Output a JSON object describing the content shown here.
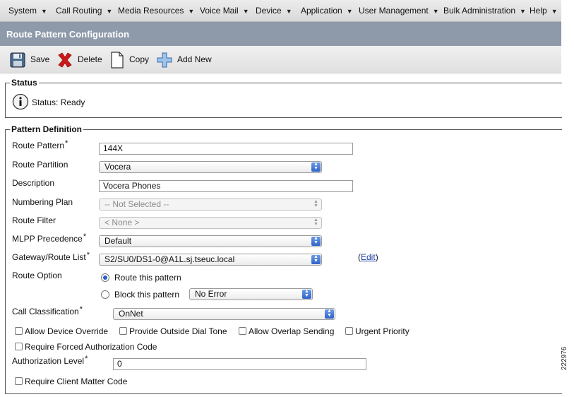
{
  "menu": [
    "System",
    "Call Routing",
    "Media Resources",
    "Voice Mail",
    "Device",
    "Application",
    "User Management",
    "Bulk Administration",
    "Help"
  ],
  "page_title": "Route Pattern Configuration",
  "toolbar": {
    "save": "Save",
    "delete": "Delete",
    "copy": "Copy",
    "add_new": "Add New"
  },
  "status": {
    "legend": "Status",
    "text": "Status: Ready"
  },
  "pattern": {
    "legend": "Pattern Definition",
    "route_pattern_label": "Route Pattern",
    "route_pattern_value": "144X",
    "route_partition_label": "Route Partition",
    "route_partition_value": "Vocera",
    "description_label": "Description",
    "description_value": "Vocera Phones",
    "numbering_plan_label": "Numbering Plan",
    "numbering_plan_value": "-- Not Selected --",
    "route_filter_label": "Route Filter",
    "route_filter_value": "< None >",
    "mlpp_label": "MLPP Precedence",
    "mlpp_value": "Default",
    "gateway_label": "Gateway/Route List",
    "gateway_value": "S2/SU0/DS1-0@A1L.sj.tseuc.local",
    "edit_open": "(",
    "edit_link": "Edit",
    "edit_close": ")",
    "route_option_label": "Route Option",
    "route_this": "Route this pattern",
    "block_this": "Block this pattern",
    "block_reason": "No Error",
    "call_class_label": "Call Classification",
    "call_class_value": "OnNet",
    "allow_device_override": "Allow Device Override",
    "provide_outside_dial_tone": "Provide Outside Dial Tone",
    "allow_overlap_sending": "Allow Overlap Sending",
    "urgent_priority": "Urgent Priority",
    "require_fac": "Require Forced Authorization Code",
    "auth_level_label": "Authorization Level",
    "auth_level_value": "0",
    "require_cmc": "Require Client Matter Code"
  },
  "required_mark": "*",
  "side_code": "222976"
}
